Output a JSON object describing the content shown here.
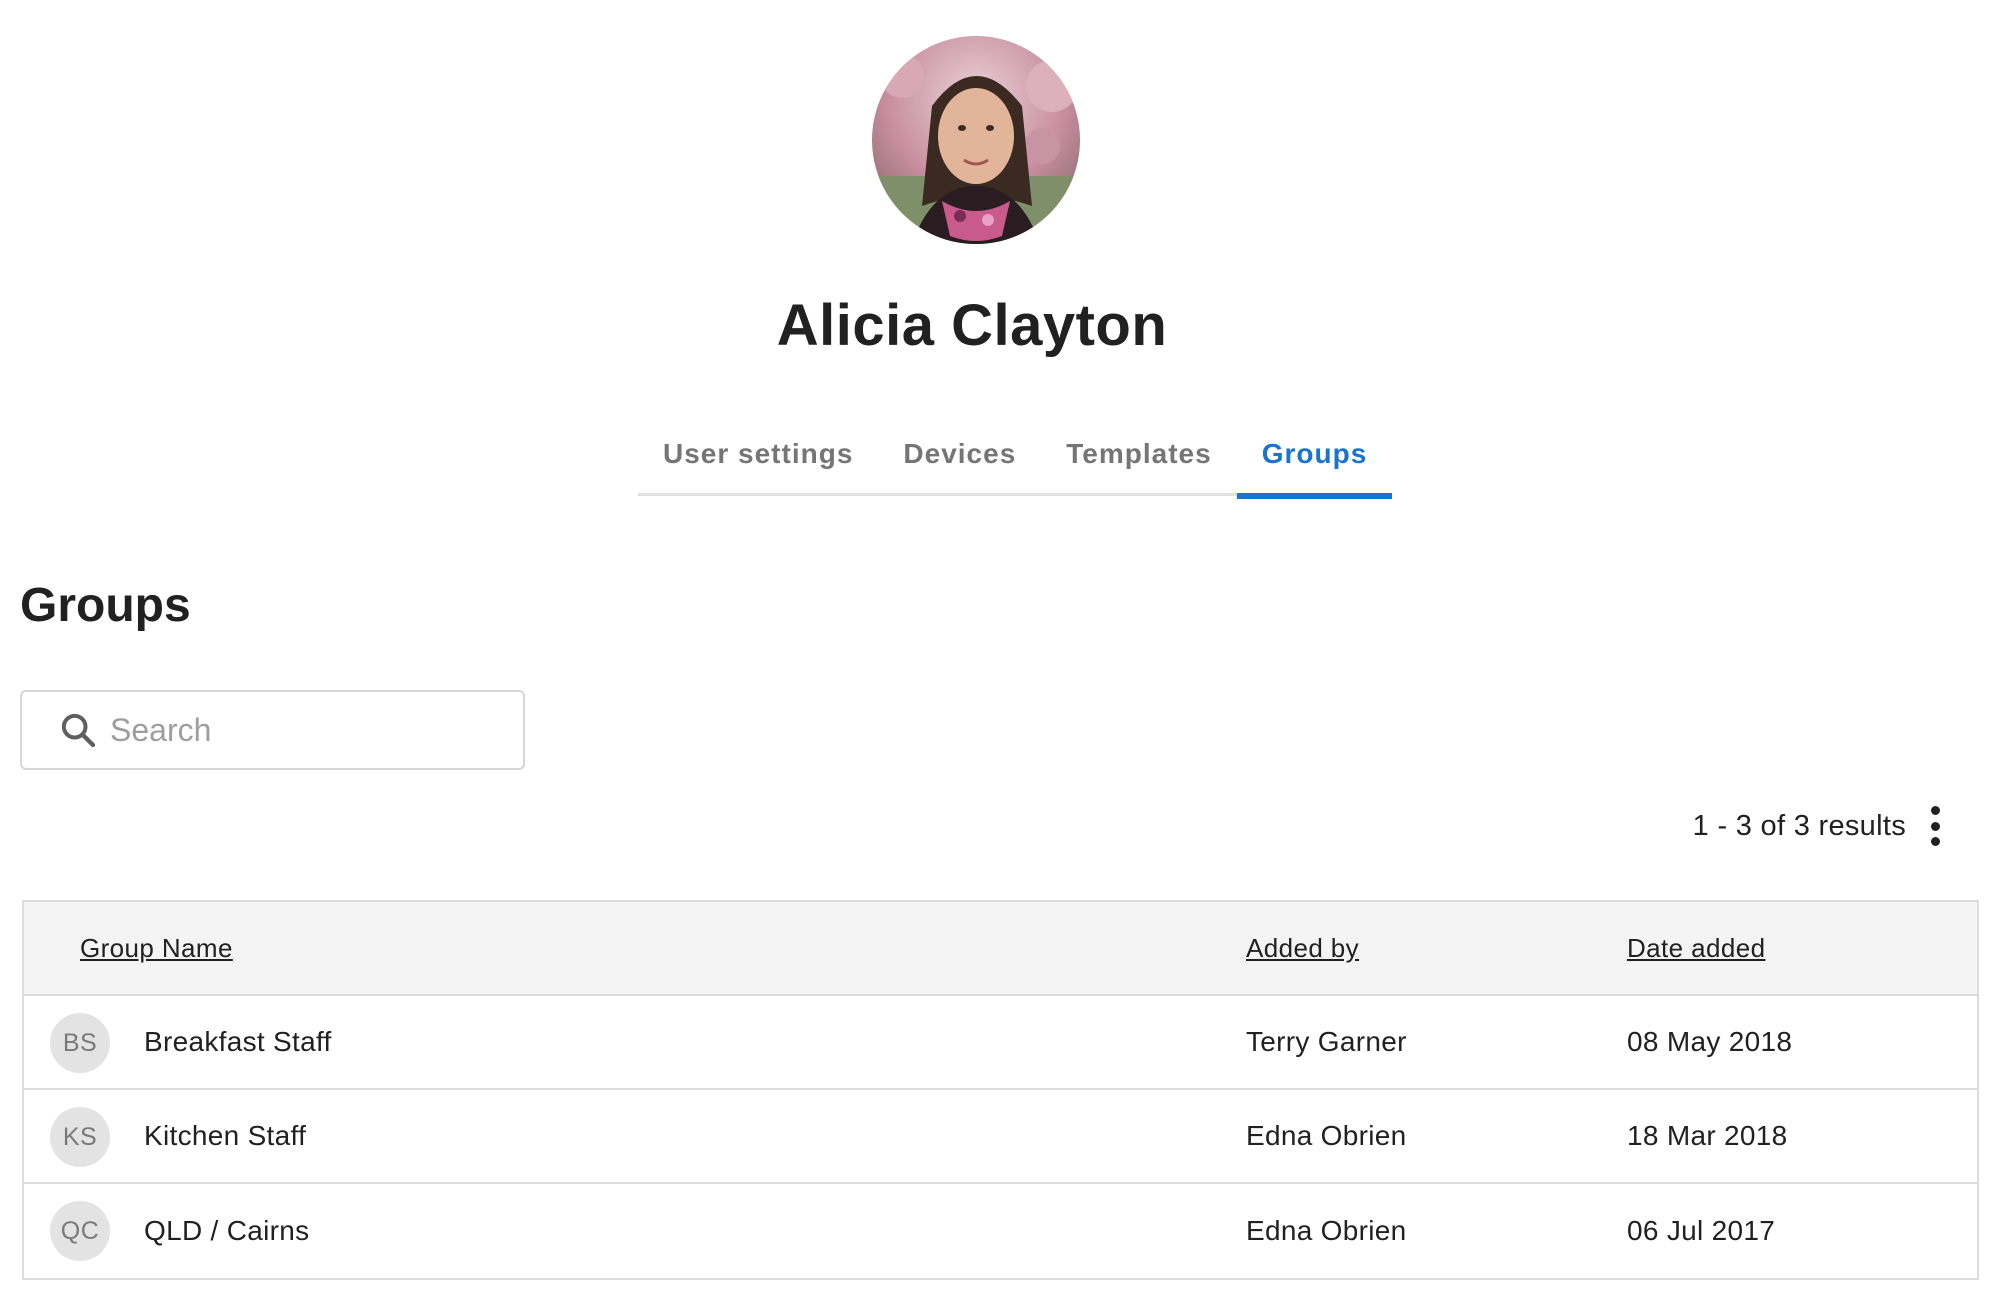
{
  "profile": {
    "name": "Alicia Clayton"
  },
  "tabs": [
    {
      "label": "User settings",
      "active": false
    },
    {
      "label": "Devices",
      "active": false
    },
    {
      "label": "Templates",
      "active": false
    },
    {
      "label": "Groups",
      "active": true
    }
  ],
  "section": {
    "title": "Groups"
  },
  "search": {
    "placeholder": "Search",
    "value": ""
  },
  "results": {
    "text": "1 - 3 of 3 results"
  },
  "table": {
    "columns": [
      "Group Name",
      "Added by",
      "Date added"
    ],
    "rows": [
      {
        "initials": "BS",
        "name": "Breakfast Staff",
        "added_by": "Terry Garner",
        "date": "08 May 2018"
      },
      {
        "initials": "KS",
        "name": "Kitchen Staff",
        "added_by": "Edna Obrien",
        "date": "18 Mar 2018"
      },
      {
        "initials": "QC",
        "name": "QLD / Cairns",
        "added_by": "Edna Obrien",
        "date": "06 Jul 2017"
      }
    ]
  },
  "colors": {
    "accent": "#1a73cf",
    "tab_inactive": "#757575",
    "header_bg": "#f4f4f4",
    "border": "#dcdcdc"
  },
  "icons": {
    "search": "search-icon",
    "more": "more-vertical-icon"
  }
}
